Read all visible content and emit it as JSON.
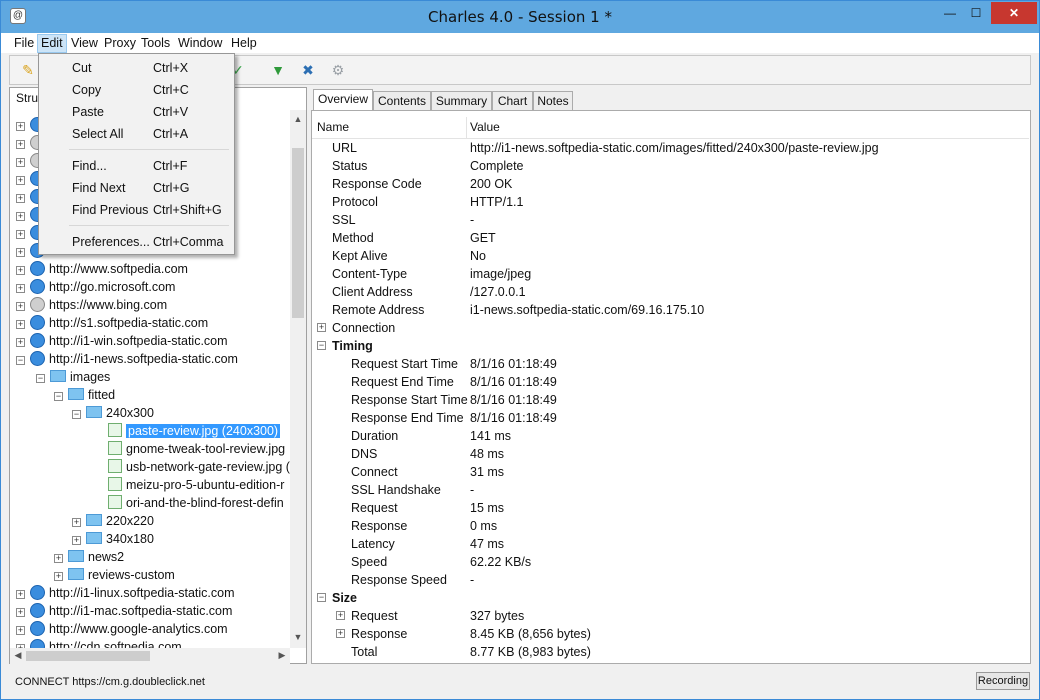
{
  "window": {
    "title": "Charles 4.0 - Session 1 *",
    "min": "—",
    "max": "☐",
    "close": "✕",
    "app_icon": "charles-app-icon"
  },
  "menu": [
    "File",
    "Edit",
    "View",
    "Proxy",
    "Tools",
    "Window",
    "Help"
  ],
  "toolbar": {
    "icons": [
      "broom-icon",
      "check-icon",
      "basket-icon",
      "tools-icon",
      "gear-icon"
    ]
  },
  "left_pane": {
    "header": "Stru",
    "tree": [
      {
        "label": "http://www.softpedia.com"
      },
      {
        "label": "http://go.microsoft.com"
      },
      {
        "label": "https://www.bing.com"
      },
      {
        "label": "http://s1.softpedia-static.com"
      },
      {
        "label": "http://i1-win.softpedia-static.com"
      },
      {
        "label": "http://i1-news.softpedia-static.com"
      },
      {
        "label": "images"
      },
      {
        "label": "fitted"
      },
      {
        "label": "240x300"
      },
      {
        "label": "paste-review.jpg (240x300)"
      },
      {
        "label": "gnome-tweak-tool-review.jpg"
      },
      {
        "label": "usb-network-gate-review.jpg ("
      },
      {
        "label": "meizu-pro-5-ubuntu-edition-r"
      },
      {
        "label": "ori-and-the-blind-forest-defin"
      },
      {
        "label": "220x220"
      },
      {
        "label": "340x180"
      },
      {
        "label": "news2"
      },
      {
        "label": "reviews-custom"
      },
      {
        "label": "http://i1-linux.softpedia-static.com"
      },
      {
        "label": "http://i1-mac.softpedia-static.com"
      },
      {
        "label": "http://www.google-analytics.com"
      },
      {
        "label": "http://cdn.softpedia.com"
      }
    ],
    "partial_row_text": "n"
  },
  "edit_menu": {
    "items": [
      {
        "label": "Cut",
        "shortcut": "Ctrl+X"
      },
      {
        "label": "Copy",
        "shortcut": "Ctrl+C"
      },
      {
        "label": "Paste",
        "shortcut": "Ctrl+V"
      },
      {
        "label": "Select All",
        "shortcut": "Ctrl+A"
      },
      {
        "label": "Find...",
        "shortcut": "Ctrl+F"
      },
      {
        "label": "Find Next",
        "shortcut": "Ctrl+G"
      },
      {
        "label": "Find Previous",
        "shortcut": "Ctrl+Shift+G"
      },
      {
        "label": "Preferences...",
        "shortcut": "Ctrl+Comma"
      }
    ]
  },
  "tabs": [
    "Overview",
    "Contents",
    "Summary",
    "Chart",
    "Notes"
  ],
  "overview": {
    "col_name": "Name",
    "col_value": "Value",
    "rows": [
      {
        "name": "URL",
        "value": "http://i1-news.softpedia-static.com/images/fitted/240x300/paste-review.jpg"
      },
      {
        "name": "Status",
        "value": "Complete"
      },
      {
        "name": "Response Code",
        "value": "200 OK"
      },
      {
        "name": "Protocol",
        "value": "HTTP/1.1"
      },
      {
        "name": "SSL",
        "value": "-"
      },
      {
        "name": "Method",
        "value": "GET"
      },
      {
        "name": "Kept Alive",
        "value": "No"
      },
      {
        "name": "Content-Type",
        "value": "image/jpeg"
      },
      {
        "name": "Client Address",
        "value": "/127.0.0.1"
      },
      {
        "name": "Remote Address",
        "value": "i1-news.softpedia-static.com/69.16.175.10"
      },
      {
        "name": "Connection",
        "value": ""
      },
      {
        "name": "Timing",
        "value": ""
      },
      {
        "name": "Request Start Time",
        "value": "8/1/16 01:18:49"
      },
      {
        "name": "Request End Time",
        "value": "8/1/16 01:18:49"
      },
      {
        "name": "Response Start Time",
        "value": "8/1/16 01:18:49"
      },
      {
        "name": "Response End Time",
        "value": "8/1/16 01:18:49"
      },
      {
        "name": "Duration",
        "value": "141 ms"
      },
      {
        "name": "DNS",
        "value": "48 ms"
      },
      {
        "name": "Connect",
        "value": "31 ms"
      },
      {
        "name": "SSL Handshake",
        "value": "-"
      },
      {
        "name": "Request",
        "value": "15 ms"
      },
      {
        "name": "Response",
        "value": "0 ms"
      },
      {
        "name": "Latency",
        "value": "47 ms"
      },
      {
        "name": "Speed",
        "value": "62.22 KB/s"
      },
      {
        "name": "Response Speed",
        "value": "-"
      },
      {
        "name": "Size",
        "value": ""
      },
      {
        "name": "Request",
        "value": "327 bytes"
      },
      {
        "name": "Response",
        "value": "8.45 KB (8,656 bytes)"
      },
      {
        "name": "Total",
        "value": "8.77 KB (8,983 bytes)"
      }
    ]
  },
  "status": {
    "text": "CONNECT https://cm.g.doubleclick.net",
    "recording": "Recording"
  }
}
